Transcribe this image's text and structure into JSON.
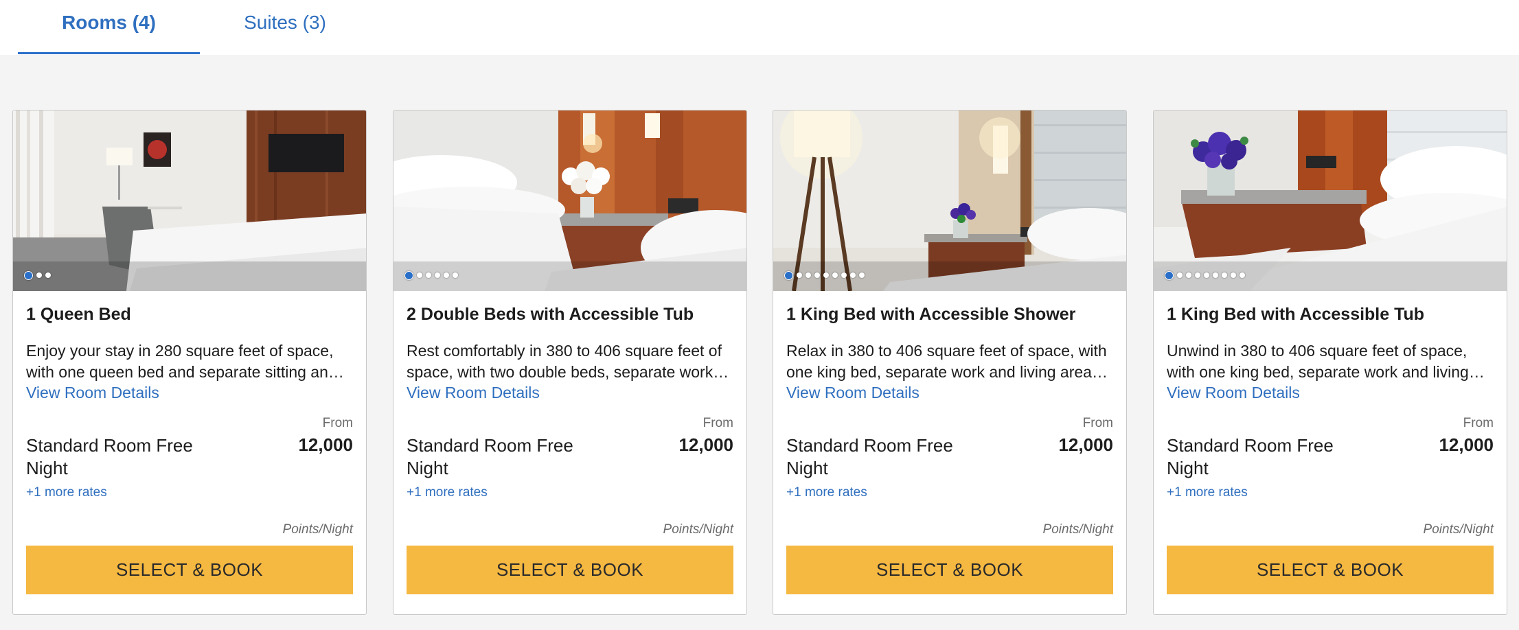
{
  "tabs": [
    {
      "label": "Rooms (4)",
      "active": true
    },
    {
      "label": "Suites (3)",
      "active": false
    }
  ],
  "colors": {
    "link": "#2f6fbf",
    "accent": "#2a6fc8",
    "book_button": "#f5b841"
  },
  "rooms": [
    {
      "title": "1 Queen Bed",
      "desc_line1": "Enjoy your stay in 280 square feet of space,",
      "desc_line2": "with one queen bed and separate sitting an…",
      "details_link": "View Room Details",
      "from_label": "From",
      "rate_name": "Standard Room Free Night",
      "points": "12,000",
      "more_rates": "+1 more rates",
      "per_night": "Points/Night",
      "button": "SELECT & BOOK",
      "photo_count": 3
    },
    {
      "title": "2 Double Beds with Accessible Tub",
      "desc_line1": "Rest comfortably in 380 to 406 square feet of",
      "desc_line2": "space, with two double beds, separate work…",
      "details_link": "View Room Details",
      "from_label": "From",
      "rate_name": "Standard Room Free Night",
      "points": "12,000",
      "more_rates": "+1 more rates",
      "per_night": "Points/Night",
      "button": "SELECT & BOOK",
      "photo_count": 6
    },
    {
      "title": "1 King Bed with Accessible Shower",
      "desc_line1": "Relax in 380 to 406 square feet of space, with",
      "desc_line2": "one king bed, separate work and living area…",
      "details_link": "View Room Details",
      "from_label": "From",
      "rate_name": "Standard Room Free Night",
      "points": "12,000",
      "more_rates": "+1 more rates",
      "per_night": "Points/Night",
      "button": "SELECT & BOOK",
      "photo_count": 9
    },
    {
      "title": "1 King Bed with Accessible Tub",
      "desc_line1": "Unwind in 380 to 406 square feet of space,",
      "desc_line2": "with one king bed, separate work and living…",
      "details_link": "View Room Details",
      "from_label": "From",
      "rate_name": "Standard Room Free Night",
      "points": "12,000",
      "more_rates": "+1 more rates",
      "per_night": "Points/Night",
      "button": "SELECT & BOOK",
      "photo_count": 9
    }
  ]
}
